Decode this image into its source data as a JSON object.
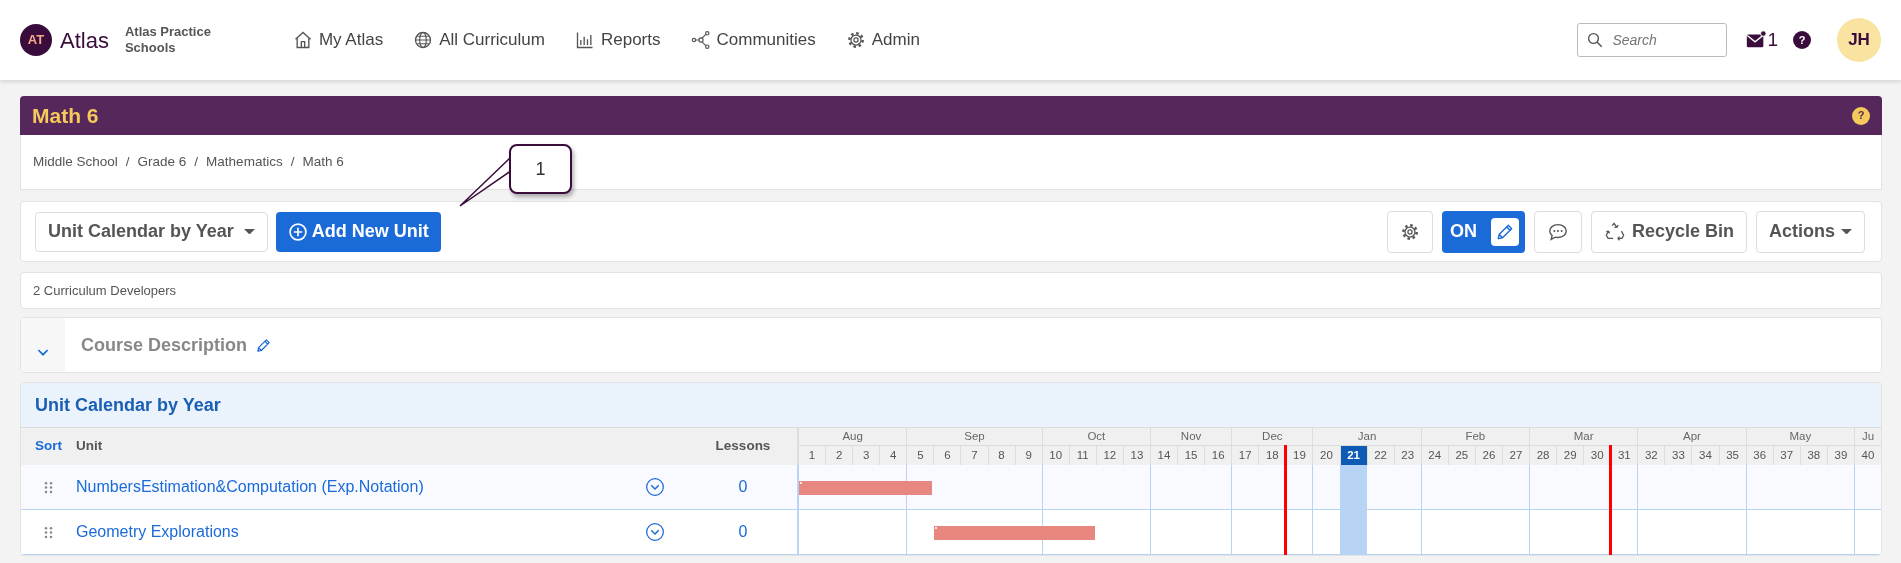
{
  "nav": {
    "logo_mark": "AT",
    "logo_text": "Atlas",
    "school": "Atlas Practice Schools",
    "items": [
      {
        "label": "My Atlas",
        "kind": "home"
      },
      {
        "label": "All Curriculum",
        "kind": "globe"
      },
      {
        "label": "Reports",
        "kind": "chart"
      },
      {
        "label": "Communities",
        "kind": "network"
      },
      {
        "label": "Admin",
        "kind": "gear"
      }
    ],
    "search": {
      "placeholder": "Search"
    },
    "messages": "1",
    "help": "?",
    "avatar": "JH"
  },
  "course": {
    "title": "Math 6",
    "help": "?"
  },
  "breadcrumb": {
    "items": [
      "Middle School",
      "Grade 6",
      "Mathematics",
      "Math 6"
    ],
    "separator": "/"
  },
  "toolbar": {
    "view_select": "Unit Calendar by Year",
    "add_button": "Add New Unit",
    "edit_toggle": {
      "label": "ON",
      "on": true
    },
    "recycle_bin": "Recycle Bin",
    "actions": "Actions"
  },
  "callout": "1",
  "developers": "2 Curriculum Developers",
  "course_description": "Course Description",
  "calendar": {
    "title": "Unit Calendar by Year",
    "columns": {
      "sort": "Sort",
      "unit": "Unit",
      "lessons": "Lessons"
    },
    "months": [
      {
        "label": "Aug",
        "weeks": [
          {
            "label": "1",
            "selected": false,
            "term_start": false
          },
          {
            "label": "2",
            "selected": false,
            "term_start": false
          },
          {
            "label": "3",
            "selected": false,
            "term_start": false
          },
          {
            "label": "4",
            "selected": false,
            "term_start": false
          }
        ]
      },
      {
        "label": "Sep",
        "weeks": [
          {
            "label": "5",
            "selected": false,
            "term_start": false
          },
          {
            "label": "6",
            "selected": false,
            "term_start": false
          },
          {
            "label": "7",
            "selected": false,
            "term_start": false
          },
          {
            "label": "8",
            "selected": false,
            "term_start": false
          },
          {
            "label": "9",
            "selected": false,
            "term_start": false
          }
        ]
      },
      {
        "label": "Oct",
        "weeks": [
          {
            "label": "10",
            "selected": false,
            "term_start": false
          },
          {
            "label": "11",
            "selected": false,
            "term_start": false
          },
          {
            "label": "12",
            "selected": false,
            "term_start": false
          },
          {
            "label": "13",
            "selected": false,
            "term_start": false
          }
        ]
      },
      {
        "label": "Nov",
        "weeks": [
          {
            "label": "14",
            "selected": false,
            "term_start": false
          },
          {
            "label": "15",
            "selected": false,
            "term_start": false
          },
          {
            "label": "16",
            "selected": false,
            "term_start": false
          }
        ]
      },
      {
        "label": "Dec",
        "weeks": [
          {
            "label": "17",
            "selected": false,
            "term_start": false
          },
          {
            "label": "18",
            "selected": false,
            "term_start": false
          },
          {
            "label": "19",
            "selected": false,
            "term_start": true
          }
        ]
      },
      {
        "label": "Jan",
        "weeks": [
          {
            "label": "20",
            "selected": false,
            "term_start": false
          },
          {
            "label": "21",
            "selected": true,
            "term_start": false
          },
          {
            "label": "22",
            "selected": false,
            "term_start": false
          },
          {
            "label": "23",
            "selected": false,
            "term_start": false
          }
        ]
      },
      {
        "label": "Feb",
        "weeks": [
          {
            "label": "24",
            "selected": false,
            "term_start": false
          },
          {
            "label": "25",
            "selected": false,
            "term_start": false
          },
          {
            "label": "26",
            "selected": false,
            "term_start": false
          },
          {
            "label": "27",
            "selected": false,
            "term_start": false
          }
        ]
      },
      {
        "label": "Mar",
        "weeks": [
          {
            "label": "28",
            "selected": false,
            "term_start": false
          },
          {
            "label": "29",
            "selected": false,
            "term_start": false
          },
          {
            "label": "30",
            "selected": false,
            "term_start": false
          },
          {
            "label": "31",
            "selected": false,
            "term_start": true
          }
        ]
      },
      {
        "label": "Apr",
        "weeks": [
          {
            "label": "32",
            "selected": false,
            "term_start": false
          },
          {
            "label": "33",
            "selected": false,
            "term_start": false
          },
          {
            "label": "34",
            "selected": false,
            "term_start": false
          },
          {
            "label": "35",
            "selected": false,
            "term_start": false
          }
        ]
      },
      {
        "label": "May",
        "weeks": [
          {
            "label": "36",
            "selected": false,
            "term_start": false
          },
          {
            "label": "37",
            "selected": false,
            "term_start": false
          },
          {
            "label": "38",
            "selected": false,
            "term_start": false
          },
          {
            "label": "39",
            "selected": false,
            "term_start": false
          }
        ]
      },
      {
        "label": "Ju",
        "weeks": [
          {
            "label": "40",
            "selected": false,
            "term_start": false
          }
        ]
      }
    ],
    "rows": [
      {
        "unit": "NumbersEstimation&Computation (Exp.Notation)",
        "lessons": "0",
        "scheduled": [
          true,
          true,
          true,
          true,
          true,
          false,
          false,
          false,
          false,
          false,
          false,
          false,
          false,
          false,
          false,
          false,
          false,
          false,
          false,
          false,
          false,
          false,
          false,
          false,
          false,
          false,
          false,
          false,
          false,
          false,
          false,
          false,
          false,
          false,
          false,
          false,
          false,
          false,
          false,
          false
        ]
      },
      {
        "unit": "Geometry Explorations",
        "lessons": "0",
        "scheduled": [
          false,
          false,
          false,
          false,
          false,
          true,
          true,
          true,
          true,
          true,
          true,
          false,
          false,
          false,
          false,
          false,
          false,
          false,
          false,
          false,
          false,
          false,
          false,
          false,
          false,
          false,
          false,
          false,
          false,
          false,
          false,
          false,
          false,
          false,
          false,
          false,
          false,
          false,
          false,
          false
        ]
      }
    ]
  }
}
